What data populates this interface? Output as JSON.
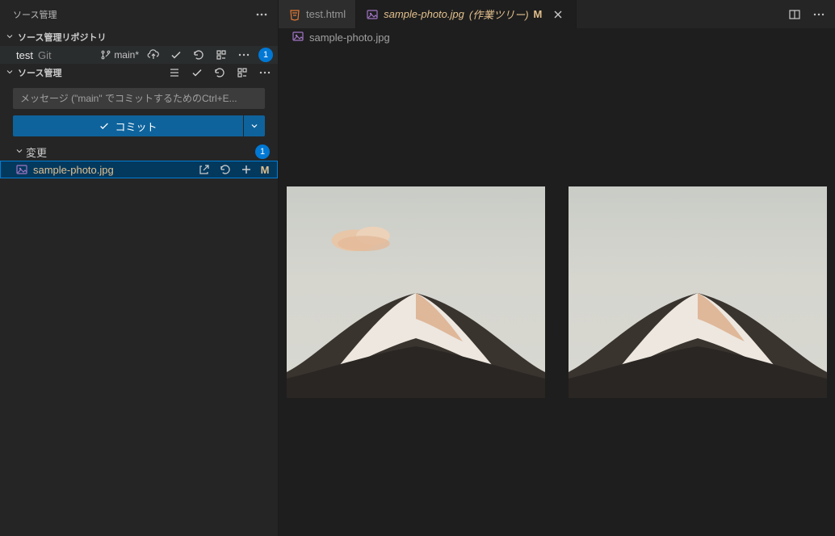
{
  "panel": {
    "title": "ソース管理",
    "repos_header": "ソース管理リポジトリ",
    "scm_header": "ソース管理"
  },
  "repo": {
    "name": "test",
    "type": "Git",
    "branch": "main*",
    "pending_count": "1"
  },
  "commit": {
    "placeholder": "メッセージ (\"main\" でコミットするためのCtrl+E...",
    "button_label": "コミット"
  },
  "changes": {
    "label": "変更",
    "count": "1",
    "files": [
      {
        "name": "sample-photo.jpg",
        "status": "M"
      }
    ]
  },
  "tabs": {
    "inactive": "test.html",
    "active_name": "sample-photo.jpg",
    "active_suffix": "(作業ツリー)",
    "active_status": "M"
  },
  "breadcrumb": {
    "file": "sample-photo.jpg"
  }
}
